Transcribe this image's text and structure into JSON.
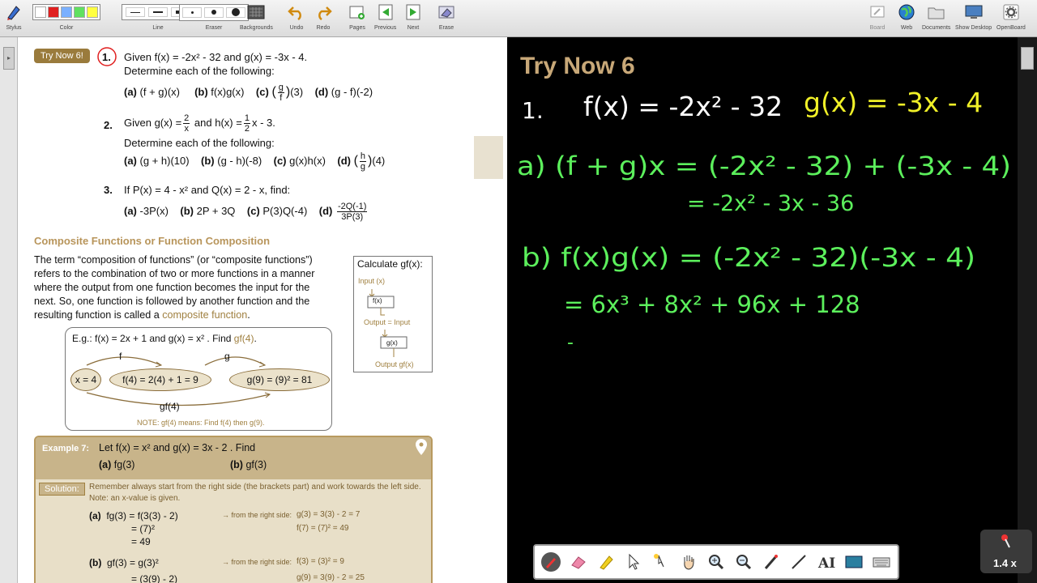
{
  "toolbar": {
    "stylus": "Stylus",
    "color": "Color",
    "line": "Line",
    "eraser": "Eraser",
    "backgrounds": "Backgrounds",
    "undo": "Undo",
    "redo": "Redo",
    "pages": "Pages",
    "previous": "Previous",
    "next": "Next",
    "erase": "Erase",
    "board": "Board",
    "web": "Web",
    "documents": "Documents",
    "show_desktop": "Show Desktop",
    "openboard": "OpenBoard",
    "colors": [
      "#ffffff",
      "#e02020",
      "#7ab0ff",
      "#60e060",
      "#ffff40"
    ]
  },
  "doc": {
    "badge": "Try Now 6!",
    "q1_num": "1.",
    "q1_line1": "Given f(x) = -2x² - 32 and g(x) = -3x - 4.",
    "q1_line2": "Determine each of the following:",
    "q1_a": "(a)",
    "q1_a_t": "(f + g)(x)",
    "q1_b": "(b)",
    "q1_b_t": "f(x)g(x)",
    "q1_c": "(c)",
    "q1_c_num": "g",
    "q1_c_den": "f",
    "q1_c_t": "(3)",
    "q1_d": "(d)",
    "q1_d_t": "(g - f)(-2)",
    "q2_num": "2.",
    "q2_given": "Given g(x) =",
    "q2_g_num": "2",
    "q2_g_den": "x",
    "q2_and": "and h(x) =",
    "q2_h_num": "1",
    "q2_h_den": "2",
    "q2_h_t": "x - 3.",
    "q2_line2": "Determine each of the following:",
    "q2_a": "(a)",
    "q2_a_t": "(g + h)(10)",
    "q2_b": "(b)",
    "q2_b_t": "(g - h)(-8)",
    "q2_c": "(c)",
    "q2_c_t": "g(x)h(x)",
    "q2_d": "(d)",
    "q2_d_num": "h",
    "q2_d_den": "g",
    "q2_d_t": "(4)",
    "q3_num": "3.",
    "q3_line1": "If P(x) = 4 - x²  and Q(x) = 2 - x, find:",
    "q3_a": "(a)",
    "q3_a_t": "-3P(x)",
    "q3_b": "(b)",
    "q3_b_t": "2P + 3Q",
    "q3_c": "(c)",
    "q3_c_t": "P(3)Q(-4)",
    "q3_d": "(d)",
    "q3_d_num": "-2Q(-1)",
    "q3_d_den": "3P(3)",
    "heading": "Composite Functions or Function Composition",
    "para": [
      "The term “composition of functions” (or “composite functions”)",
      "refers to the combination of two or more functions in a manner",
      "where the output from one function becomes the input for the",
      "next. So, one function is followed by another function and the",
      "resulting function is called a"
    ],
    "para_link": "composite function",
    "para_end": ".",
    "calc_title": "Calculate gf(x):",
    "calc_input": "Input (x)",
    "calc_f": "f(x)",
    "calc_out": "Output = Input",
    "calc_g": "g(x)",
    "calc_final": "Output gf(x)",
    "eg_text": "E.g.:  f(x) = 2x + 1   and g(x) = x² .  Find",
    "eg_find": "gf(4)",
    "eg_end": ".",
    "eg_x": "x = 4",
    "eg_f4": "f(4) = 2(4) + 1 = 9",
    "eg_g9": "g(9) = (9)² = 81",
    "eg_lbl_f": "f",
    "eg_lbl_g": "g",
    "eg_lbl_gf": "gf(4)",
    "eg_note": "NOTE: gf(4) means: Find f(4) then g(9).",
    "ex_label": "Example 7:",
    "ex_text": "Let  f(x) = x²  and  g(x) = 3x - 2 .  Find",
    "ex_a": "(a)",
    "ex_a_t": "fg(3)",
    "ex_b": "(b)",
    "ex_b_t": "gf(3)",
    "sol_label": "Solution:",
    "sol_line1": "Remember always start from the right side (the brackets part) and work towards the left side.",
    "sol_line2": "Note: an x-value is given.",
    "s_a": "(a)",
    "s_a1": "fg(3) = f(3(3) - 2)",
    "s_a2": "= (7)²",
    "s_a3": "= 49",
    "s_a_arrow": "→ from the right side:",
    "s_a_r1": "g(3) = 3(3) - 2 = 7",
    "s_a_r2": "f(7) = (7)² = 49",
    "s_b": "(b)",
    "s_b1": "gf(3) = g(3)²",
    "s_b2": "= (3(9) - 2)",
    "s_b_arrow": "→ from the right side:",
    "s_b_r1": "f(3) = (3)² = 9",
    "s_b_r2": "g(9) = 3(9) - 2 = 25"
  },
  "board": {
    "title": "Try Now 6",
    "title_color": "#c8a878",
    "ink_white": "#ffffff",
    "ink_yellow": "#f0f028",
    "ink_green": "#5cf05c",
    "line1_num": "1.",
    "line1_f": "f(x) = -2x² - 32",
    "line1_g": "g(x) = -3x - 4",
    "line_a": "a) (f + g)x = (-2x² - 32) + (-3x - 4)",
    "line_a2": "= -2x² - 3x - 36",
    "line_b": "b) f(x)g(x) = (-2x² - 32)(-3x - 4)",
    "line_b2": "= 6x³ + 8x² + 96x + 128",
    "line_b3": "-"
  },
  "bottom_tools": [
    "pen-tool",
    "eraser-tool",
    "marker-tool",
    "select-tool",
    "laser-tool",
    "hand-tool",
    "zoom-in-tool",
    "zoom-out-tool",
    "pointer-tool",
    "line-tool",
    "text-tool",
    "capture-tool",
    "keyboard-tool"
  ],
  "zoom_label": "1.4 x"
}
